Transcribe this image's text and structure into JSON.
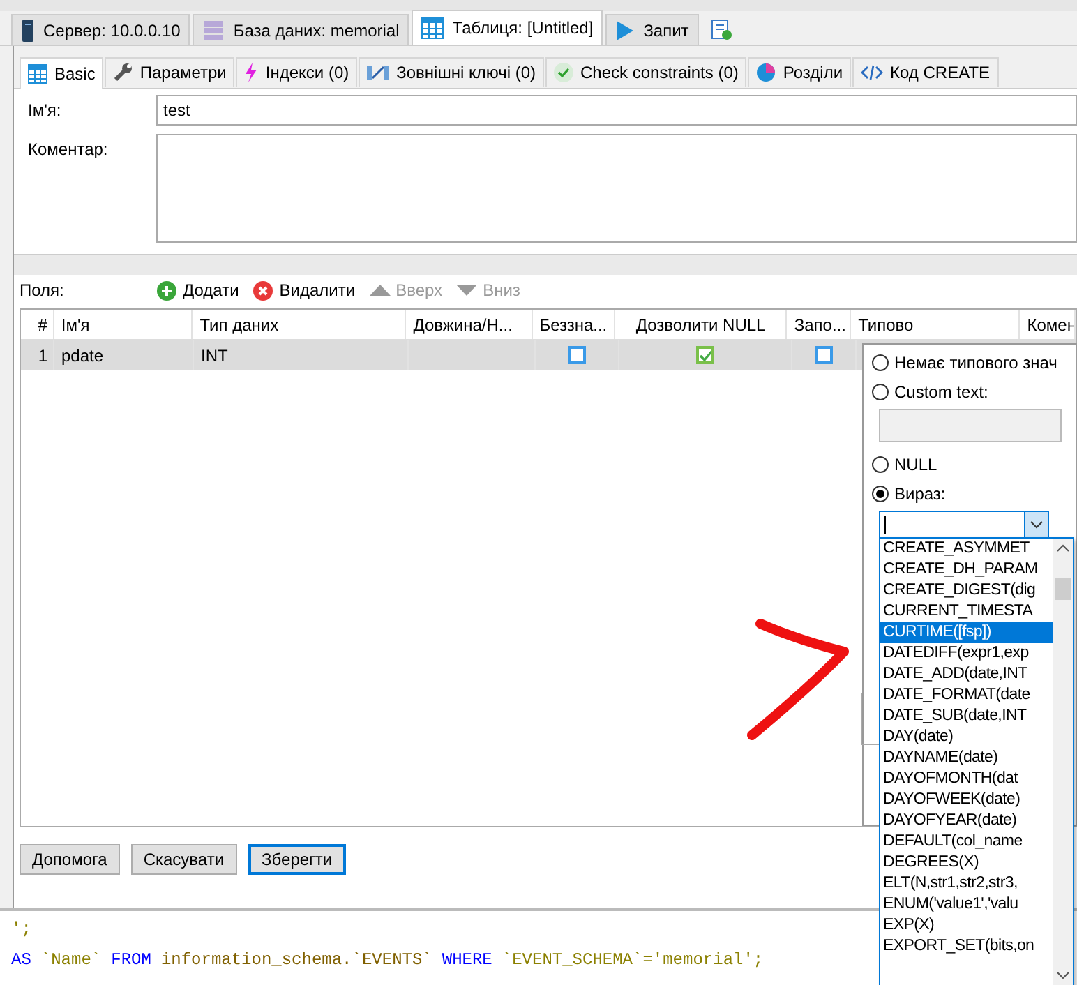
{
  "top_tabs": [
    {
      "label": "Сервер: 10.0.0.10",
      "kind": "server",
      "selected": false
    },
    {
      "label": "База даних: memorial",
      "kind": "database",
      "selected": false
    },
    {
      "label": "Таблиця: [Untitled]",
      "kind": "table",
      "selected": true
    },
    {
      "label": "Запит",
      "kind": "query",
      "selected": false
    }
  ],
  "inner_tabs": [
    {
      "label": "Basic",
      "kind": "table",
      "selected": true
    },
    {
      "label": "Параметри",
      "kind": "wrench",
      "selected": false
    },
    {
      "label": "Індекси (0)",
      "kind": "bolt",
      "selected": false
    },
    {
      "label": "Зовнішні ключі (0)",
      "kind": "link",
      "selected": false
    },
    {
      "label": "Check constraints (0)",
      "kind": "check",
      "selected": false
    },
    {
      "label": "Розділи",
      "kind": "pie",
      "selected": false
    },
    {
      "label": "Код CREATE",
      "kind": "code",
      "selected": false
    }
  ],
  "form": {
    "name_label": "Ім'я:",
    "name_value": "test",
    "comment_label": "Коментар:"
  },
  "fields_toolbar": {
    "label": "Поля:",
    "buttons": [
      {
        "label": "Додати",
        "kind": "add",
        "disabled": false
      },
      {
        "label": "Видалити",
        "kind": "remove",
        "disabled": false
      },
      {
        "label": "Вверх",
        "kind": "up",
        "disabled": true
      },
      {
        "label": "Вниз",
        "kind": "down",
        "disabled": true
      }
    ]
  },
  "table": {
    "columns": [
      "#",
      "Ім'я",
      "Тип даних",
      "Довжина/Н...",
      "Беззна...",
      "Дозволити NULL",
      "Запо...",
      "Типово",
      "Комен"
    ],
    "rows": [
      {
        "num": "1",
        "name": "pdate",
        "type": "INT",
        "unsigned": false,
        "allow_null": true,
        "zerofill": false,
        "selected": true
      }
    ]
  },
  "default_popup": {
    "options": [
      {
        "label": "Немає типового знач",
        "kind": "plain",
        "selected": false
      },
      {
        "label": "Custom text:",
        "kind": "text",
        "selected": false
      },
      {
        "label": "NULL",
        "kind": "plain",
        "selected": false
      },
      {
        "label": "Вираз:",
        "kind": "expression",
        "selected": true
      }
    ],
    "expression_list": [
      {
        "label": "CREATE_ASYMMET",
        "selected": false
      },
      {
        "label": "CREATE_DH_PARAM",
        "selected": false
      },
      {
        "label": "CREATE_DIGEST(dig",
        "selected": false
      },
      {
        "label": "CURRENT_TIMESTA",
        "selected": false
      },
      {
        "label": "CURTIME([fsp])",
        "selected": true
      },
      {
        "label": "DATEDIFF(expr1,exp",
        "selected": false
      },
      {
        "label": "DATE_ADD(date,INT",
        "selected": false
      },
      {
        "label": "DATE_FORMAT(date",
        "selected": false
      },
      {
        "label": "DATE_SUB(date,INT",
        "selected": false
      },
      {
        "label": "DAY(date)",
        "selected": false
      },
      {
        "label": "DAYNAME(date)",
        "selected": false
      },
      {
        "label": "DAYOFMONTH(dat",
        "selected": false
      },
      {
        "label": "DAYOFWEEK(date)",
        "selected": false
      },
      {
        "label": "DAYOFYEAR(date)",
        "selected": false
      },
      {
        "label": "DEFAULT(col_name",
        "selected": false
      },
      {
        "label": "DEGREES(X)",
        "selected": false
      },
      {
        "label": "ELT(N,str1,str2,str3,",
        "selected": false
      },
      {
        "label": "ENUM('value1','valu",
        "selected": false
      },
      {
        "label": "EXP(X)",
        "selected": false
      },
      {
        "label": "EXPORT_SET(bits,on",
        "selected": false
      }
    ]
  },
  "buttons": [
    {
      "label": "Допомога",
      "focused": false
    },
    {
      "label": "Скасувати",
      "focused": false
    },
    {
      "label": "Зберегти",
      "focused": true
    }
  ],
  "sql_log": [
    [
      {
        "text": "';",
        "kind": "string"
      }
    ],
    [
      {
        "text": "AS",
        "kind": "keyword"
      },
      {
        "text": "`Name`",
        "kind": "ident"
      },
      {
        "text": "FROM",
        "kind": "keyword"
      },
      {
        "text": "information_schema.`EVENTS`",
        "kind": "plain"
      },
      {
        "text": "WHERE",
        "kind": "keyword"
      },
      {
        "text": "`EVENT_SCHEMA`='memorial';",
        "kind": "ident"
      }
    ]
  ]
}
